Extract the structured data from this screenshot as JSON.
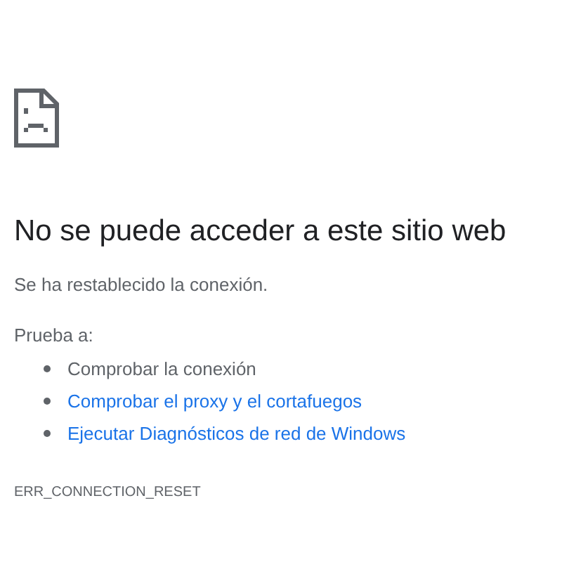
{
  "heading": "No se puede acceder a este sitio web",
  "message": "Se ha restablecido la conexión.",
  "suggestions_label": "Prueba a:",
  "suggestions": [
    {
      "kind": "text",
      "text": "Comprobar la conexión"
    },
    {
      "kind": "link",
      "text": "Comprobar el proxy y el cortafuegos"
    },
    {
      "kind": "link",
      "text": "Ejecutar Diagnósticos de red de Windows"
    }
  ],
  "error_code": "ERR_CONNECTION_RESET"
}
